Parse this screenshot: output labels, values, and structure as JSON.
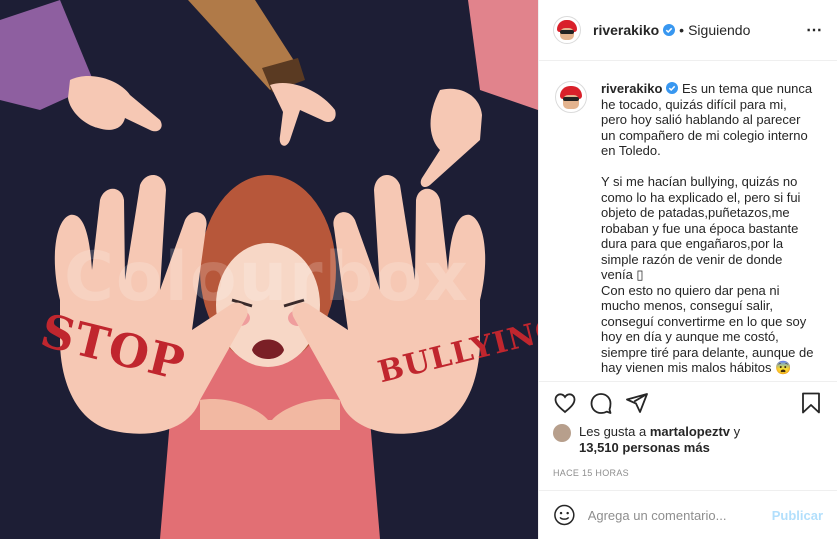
{
  "image": {
    "watermark_text": "Colourbox",
    "stop_text": "STOP",
    "bullying_text": "BULLYING"
  },
  "header": {
    "username": "riverakiko",
    "separator": "•",
    "follow_status": "Siguiendo",
    "more_icon": "⋯"
  },
  "caption": {
    "username": "riverakiko",
    "text": " Es un tema que nunca he tocado, quizás difícil para mi, pero hoy salió hablando al parecer un compañero de mi colegio interno en Toledo.\n\nY si me hacían bullying, quizás no como lo ha explicado el, pero si fui objeto de patadas,puñetazos,me robaban y fue una época bastante dura para que engañaros,por la simple razón de venir de donde venía ▯\nCon esto no quiero dar pena ni mucho menos, conseguí salir, conseguí convertirme en lo que soy hoy en día y aunque me costó, siempre tiré para delante, aunque de hay vienen mis malos hábitos 😨"
  },
  "likes": {
    "prefix": "Les gusta a ",
    "user": "martalopeztv",
    "middle": " y ",
    "count": "13,510 personas más"
  },
  "timestamp": "HACE 15 HORAS",
  "comment_box": {
    "placeholder": "Agrega un comentario...",
    "publish_label": "Publicar"
  },
  "icons": {
    "like": "heart-icon",
    "comment": "comment-icon",
    "share": "share-icon",
    "save": "bookmark-icon",
    "emoji": "emoji-icon",
    "verified": "verified-icon"
  },
  "colors": {
    "verified": "#3897f0",
    "publish_disabled": "#b2dffc",
    "stop_red": "#c0262e",
    "image_bg": "#1d1e35"
  }
}
